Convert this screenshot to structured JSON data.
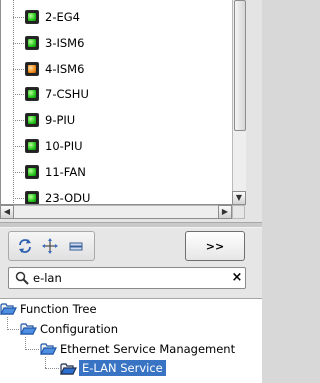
{
  "device_tree": {
    "items": [
      {
        "label": "2-EG4",
        "status": "green"
      },
      {
        "label": "3-ISM6",
        "status": "green"
      },
      {
        "label": "4-ISM6",
        "status": "orange"
      },
      {
        "label": "7-CSHU",
        "status": "green"
      },
      {
        "label": "9-PIU",
        "status": "green"
      },
      {
        "label": "10-PIU",
        "status": "green"
      },
      {
        "label": "11-FAN",
        "status": "green"
      },
      {
        "label": "23-ODU",
        "status": "green"
      }
    ],
    "status_colors": {
      "green": "#25c41a",
      "orange": "#f08a1a"
    }
  },
  "scrollbars": {
    "up_arrow": "▲",
    "down_arrow": "▼",
    "left_arrow": "◀",
    "right_arrow": "▶"
  },
  "toolbar": {
    "icons": [
      "sync-icon",
      "move-icon",
      "collapse-icon"
    ],
    "expand_label": ">>"
  },
  "search": {
    "value": "e-lan",
    "clear_label": "×"
  },
  "function_tree": {
    "root_label": "Function Tree",
    "configuration_label": "Configuration",
    "ethernet_label": "Ethernet Service Management",
    "selected_label": "E-LAN Service",
    "selection_color": "#3873c4"
  }
}
